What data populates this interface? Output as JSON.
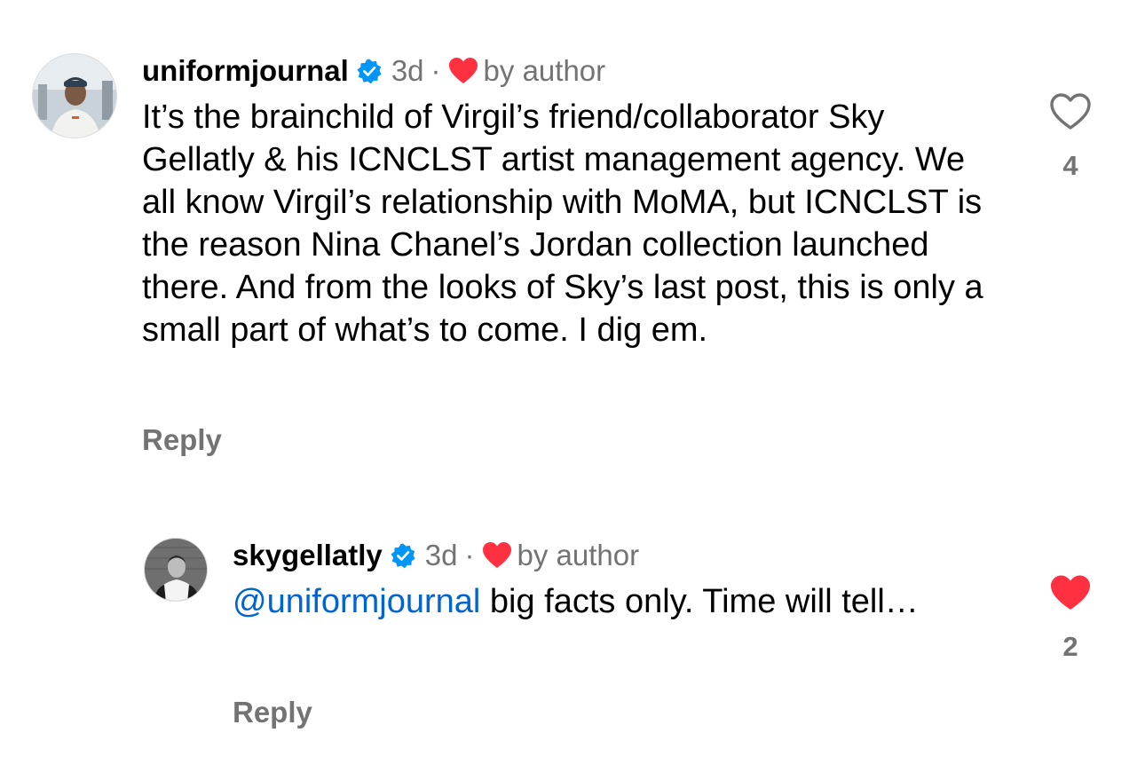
{
  "comments": [
    {
      "username": "uniformjournal",
      "time": "3d",
      "dot": "·",
      "by_author": "by author",
      "text": "It’s the brainchild of Virgil’s friend/collaborator Sky Gellatly & his ICNCLST artist management agency. We all know Virgil’s relationship with MoMA, but ICNCLST is the reason Nina Chanel’s Jordan collection launched there. And from the looks of Sky’s last post, this is only a small part of what’s to come. I dig em.",
      "reply_label": "Reply",
      "like_count": "4",
      "liked": false
    },
    {
      "username": "skygellatly",
      "time": "3d",
      "dot": "·",
      "by_author": "by author",
      "mention": "@uniformjournal",
      "text": " big facts only. Time will tell…",
      "reply_label": "Reply",
      "like_count": "2",
      "liked": true
    }
  ],
  "colors": {
    "verified": "#0095f6",
    "heart_red": "#ff3040",
    "mention": "#0064d1",
    "secondary_text": "#737373"
  },
  "icons": {
    "verified": "verified-badge-icon",
    "author_like": "heart-icon",
    "like_outline": "heart-outline-icon",
    "like_filled": "heart-filled-icon"
  }
}
